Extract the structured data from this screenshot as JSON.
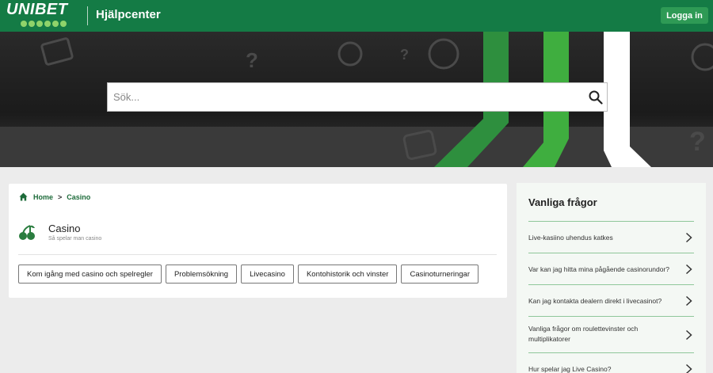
{
  "header": {
    "logo_text": "UNIBET",
    "site_title": "Hjälpcenter",
    "login_label": "Logga in"
  },
  "search": {
    "placeholder": "Sök..."
  },
  "breadcrumb": {
    "home": "Home",
    "current": "Casino"
  },
  "category": {
    "title": "Casino",
    "subtitle": "Så spelar man casino",
    "icon": "cherries-icon"
  },
  "chips": [
    "Kom igång med casino och spelregler",
    "Problemsökning",
    "Livecasino",
    "Kontohistorik och vinster",
    "Casinoturneringar"
  ],
  "faq": {
    "title": "Vanliga frågor",
    "items": [
      "Live-kasiino uhendus katkes",
      "Var kan jag hitta mina pågående casinorundor?",
      "Kan jag kontakta dealern direkt i livecasinot?",
      "Vanliga frågor om roulettevinster och multiplikatorer",
      "Hur spelar jag Live Casino?"
    ]
  },
  "colors": {
    "brand_green": "#147b45",
    "accent_green": "#2e9a55",
    "link_green": "#1d6b3a"
  }
}
